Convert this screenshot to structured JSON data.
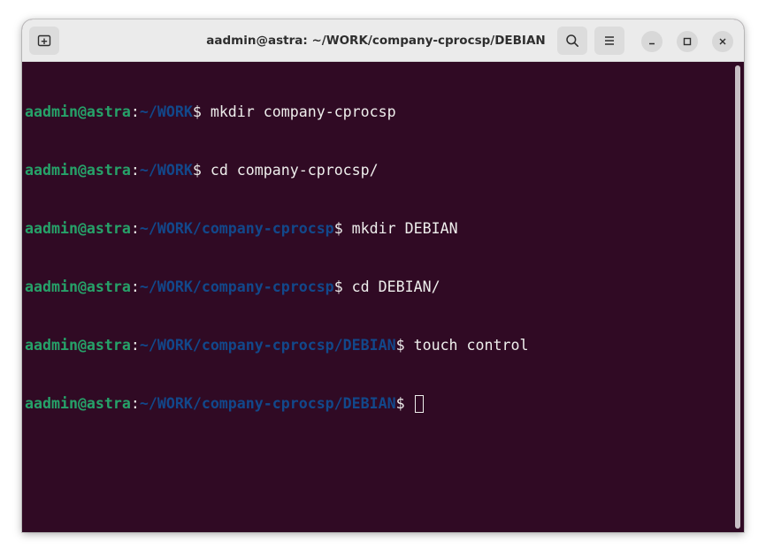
{
  "window": {
    "title": "aadmin@astra: ~/WORK/company-cprocsp/DEBIAN"
  },
  "toolbar": {
    "new_tab_icon": "new-tab-icon",
    "search_icon": "search-icon",
    "menu_icon": "hamburger-menu-icon",
    "minimize_icon": "minimize-icon",
    "maximize_icon": "maximize-icon",
    "close_icon": "close-icon"
  },
  "colors": {
    "background": "#300a24",
    "prompt_user": "#26a269",
    "prompt_path": "#12488b",
    "text": "#eeeeec"
  },
  "terminal": {
    "lines": [
      {
        "user": "aadmin@astra",
        "colon": ":",
        "path": "~/WORK",
        "dollar": "$ ",
        "cmd": "mkdir company-cprocsp"
      },
      {
        "user": "aadmin@astra",
        "colon": ":",
        "path": "~/WORK",
        "dollar": "$ ",
        "cmd": "cd company-cprocsp/"
      },
      {
        "user": "aadmin@astra",
        "colon": ":",
        "path": "~/WORK/company-cprocsp",
        "dollar": "$ ",
        "cmd": "mkdir DEBIAN"
      },
      {
        "user": "aadmin@astra",
        "colon": ":",
        "path": "~/WORK/company-cprocsp",
        "dollar": "$ ",
        "cmd": "cd DEBIAN/"
      },
      {
        "user": "aadmin@astra",
        "colon": ":",
        "path": "~/WORK/company-cprocsp/DEBIAN",
        "dollar": "$ ",
        "cmd": "touch control"
      },
      {
        "user": "aadmin@astra",
        "colon": ":",
        "path": "~/WORK/company-cprocsp/DEBIAN",
        "dollar": "$ ",
        "cmd": ""
      }
    ]
  }
}
